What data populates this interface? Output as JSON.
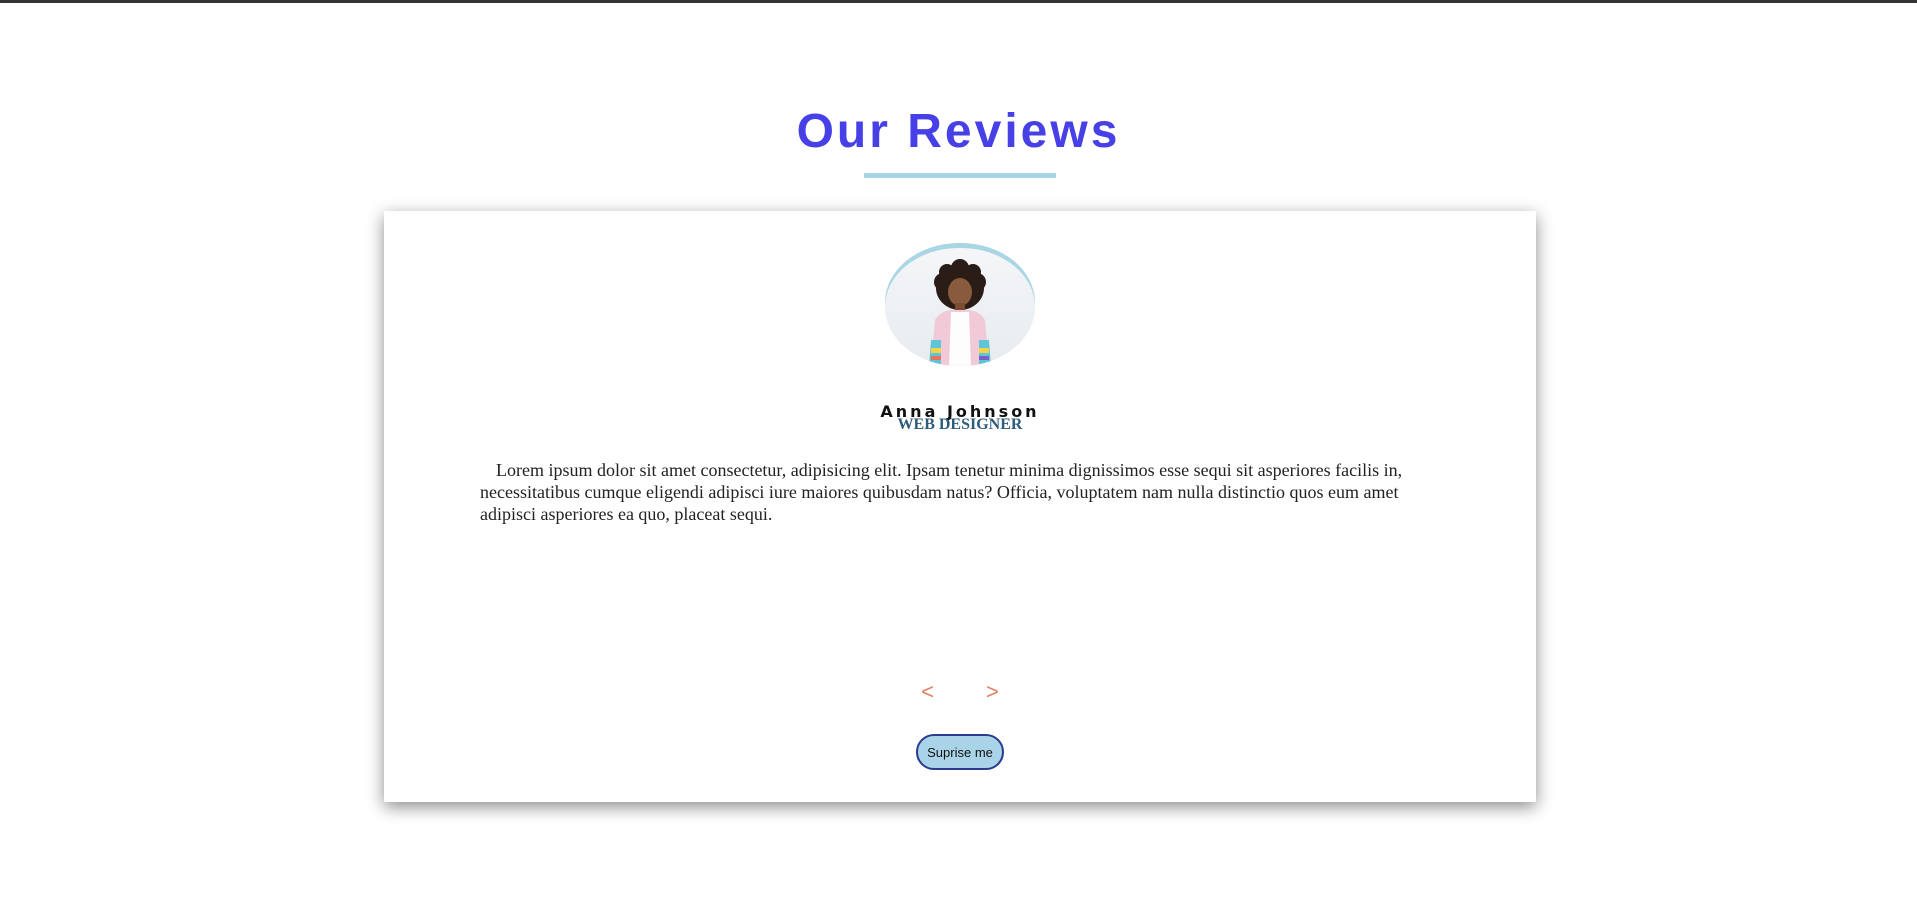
{
  "header": {
    "title": "Our Reviews"
  },
  "review": {
    "name": "Anna Johnson",
    "job": "WEB DESIGNER",
    "text": "Lorem ipsum dolor sit amet consectetur, adipisicing elit. Ipsam tenetur minima dignissimos esse sequi sit asperiores facilis in, necessitatibus cumque eligendi adipisci iure maiores quibusdam natus? Officia, voluptatem nam nulla distinctio quos eum amet adipisci asperiores ea quo, placeat sequi.",
    "avatar": "person-photo"
  },
  "controls": {
    "prev_label": "<",
    "next_label": ">",
    "random_label": "Suprise me"
  },
  "colors": {
    "title": "#4640e6",
    "underline": "#a8d4e6",
    "job": "#2d5d7b",
    "nav": "#e08163",
    "random_bg": "#a9d4e8",
    "random_border": "#2b3a8e"
  }
}
